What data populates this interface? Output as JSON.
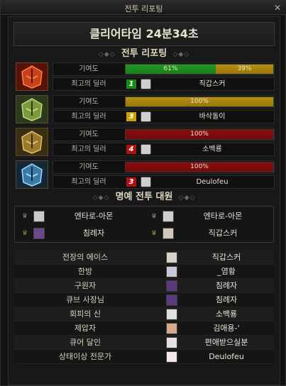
{
  "window": {
    "title": "전투 리포팅",
    "close_glyph": "✕"
  },
  "clear_time": "클리어타임  24분34초",
  "section_report": "전투 리포팅",
  "section_honor": "명예 전투 대원",
  "contribution_label": "기여도",
  "top_dealer_label": "최고의 딜러",
  "colors": {
    "green": "#1f9a1f",
    "gold": "#b8900e",
    "red": "#8a0c0c"
  },
  "parties": [
    {
      "portrait_icon": "red-helmet-icon",
      "bars": [
        {
          "label": "61%",
          "value": 61,
          "color": "green"
        },
        {
          "label": "39%",
          "value": 39,
          "color": "gold"
        }
      ],
      "dealer": {
        "rank": "1",
        "rank_color": "#1a8a1a",
        "name": "직갑스커"
      }
    },
    {
      "portrait_icon": "green-helmet-icon",
      "bars": [
        {
          "label": "100%",
          "value": 100,
          "color": "gold"
        }
      ],
      "dealer": {
        "rank": "3",
        "rank_color": "#c9a10c",
        "name": "바삭돌이"
      }
    },
    {
      "portrait_icon": "gold-helmet-icon",
      "bars": [
        {
          "label": "100%",
          "value": 100,
          "color": "red"
        }
      ],
      "dealer": {
        "rank": "4",
        "rank_color": "#b01010",
        "name": "소백룡"
      }
    },
    {
      "portrait_icon": "blue-helmet-icon",
      "bars": [
        {
          "label": "100%",
          "value": 100,
          "color": "red"
        }
      ],
      "dealer": {
        "rank": "3",
        "rank_color": "#b01010",
        "name": "Deulofeu"
      }
    }
  ],
  "honor_members": [
    {
      "name": "엔타로-아몬"
    },
    {
      "name": "엔타로-아몬"
    },
    {
      "name": "침례자"
    },
    {
      "name": "직갑스커"
    }
  ],
  "titles": [
    {
      "title": "전장의 에이스",
      "player": "직갑스커"
    },
    {
      "title": "한방",
      "player": "_염황"
    },
    {
      "title": "구원자",
      "player": "침례자"
    },
    {
      "title": "큐브 사장님",
      "player": "침례자"
    },
    {
      "title": "회피의 신",
      "player": "소백룡"
    },
    {
      "title": "제압자",
      "player": "김애용-'"
    },
    {
      "title": "큐어 달인",
      "player": "편애받으실분"
    },
    {
      "title": "상태이상 전문가",
      "player": "Deulofeu"
    }
  ]
}
